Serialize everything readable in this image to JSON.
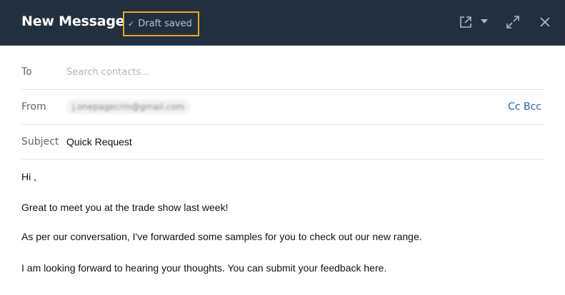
{
  "header": {
    "title": "New Message",
    "draft_status": "Draft saved",
    "draft_check_icon": "check-icon",
    "icons": [
      "external-link-icon",
      "caret-down-icon",
      "expand-icon",
      "close-icon"
    ],
    "background_color": "#222f3e",
    "highlight_color": "#f5a623"
  },
  "fields": {
    "to_label": "To",
    "to_placeholder": "Search contacts...",
    "to_value": "",
    "from_label": "From",
    "from_value": "j.onepagecrm@gmail.com",
    "cc_bcc_label": "Cc Bcc",
    "subject_label": "Subject",
    "subject_value": "Quick Request"
  },
  "body": {
    "lines": [
      "Hi ,",
      "Great to meet you at the trade show last week!",
      "As per our conversation, I've forwarded some samples for you to check out our new range.",
      "I am looking forward to hearing your thoughts. You can submit your feedback here."
    ]
  }
}
